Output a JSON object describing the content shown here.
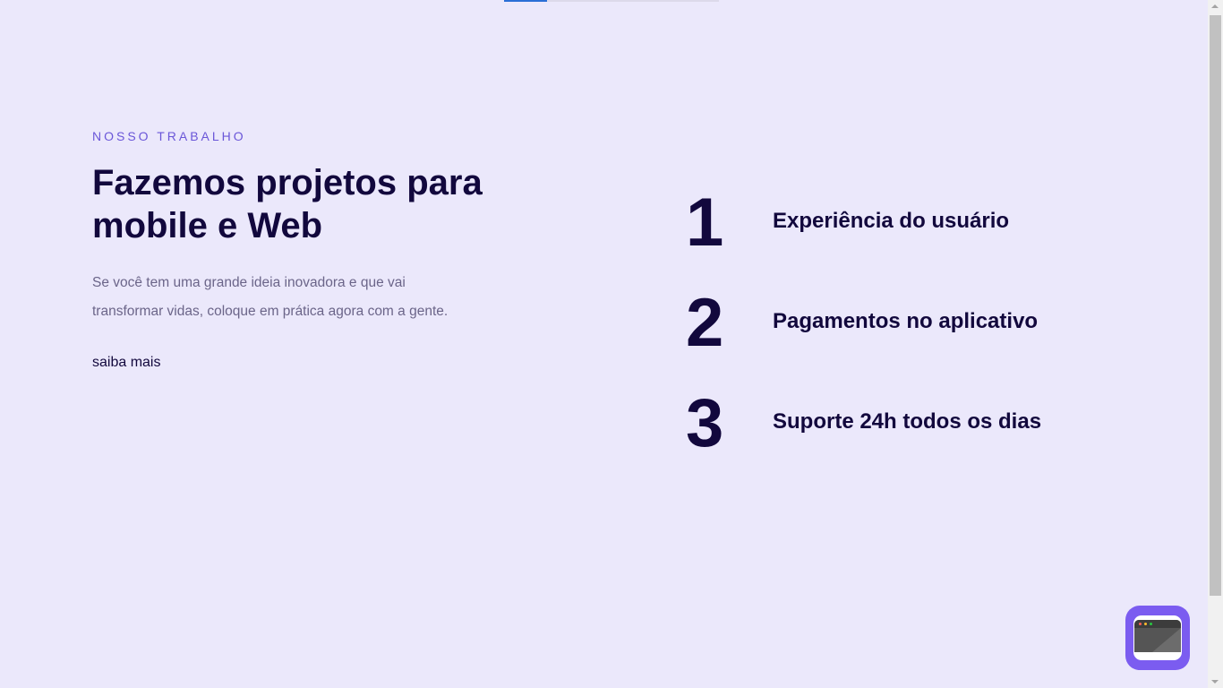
{
  "progress": {
    "value_percent": 20,
    "color": "#2a6fd6"
  },
  "section": {
    "eyebrow": "NOSSO TRABALHO",
    "title_line1": "Fazemos projetos para",
    "title_line2": "mobile e Web",
    "description_line1": "Se você tem uma grande ideia inovadora e que vai",
    "description_line2": "transformar vidas, coloque em prática agora com a gente.",
    "link_label": "saiba mais"
  },
  "features": [
    {
      "number": "1",
      "label": "Experiência do usuário"
    },
    {
      "number": "2",
      "label": "Pagamentos no aplicativo"
    },
    {
      "number": "3",
      "label": "Suporte 24h todos os dias"
    }
  ],
  "floating_button": {
    "icon": "browser-window-icon",
    "color": "#7b5cf0"
  },
  "colors": {
    "background": "#ebe8fb",
    "heading": "#12083d",
    "accent": "#6a56d8",
    "muted": "#6b6589"
  }
}
